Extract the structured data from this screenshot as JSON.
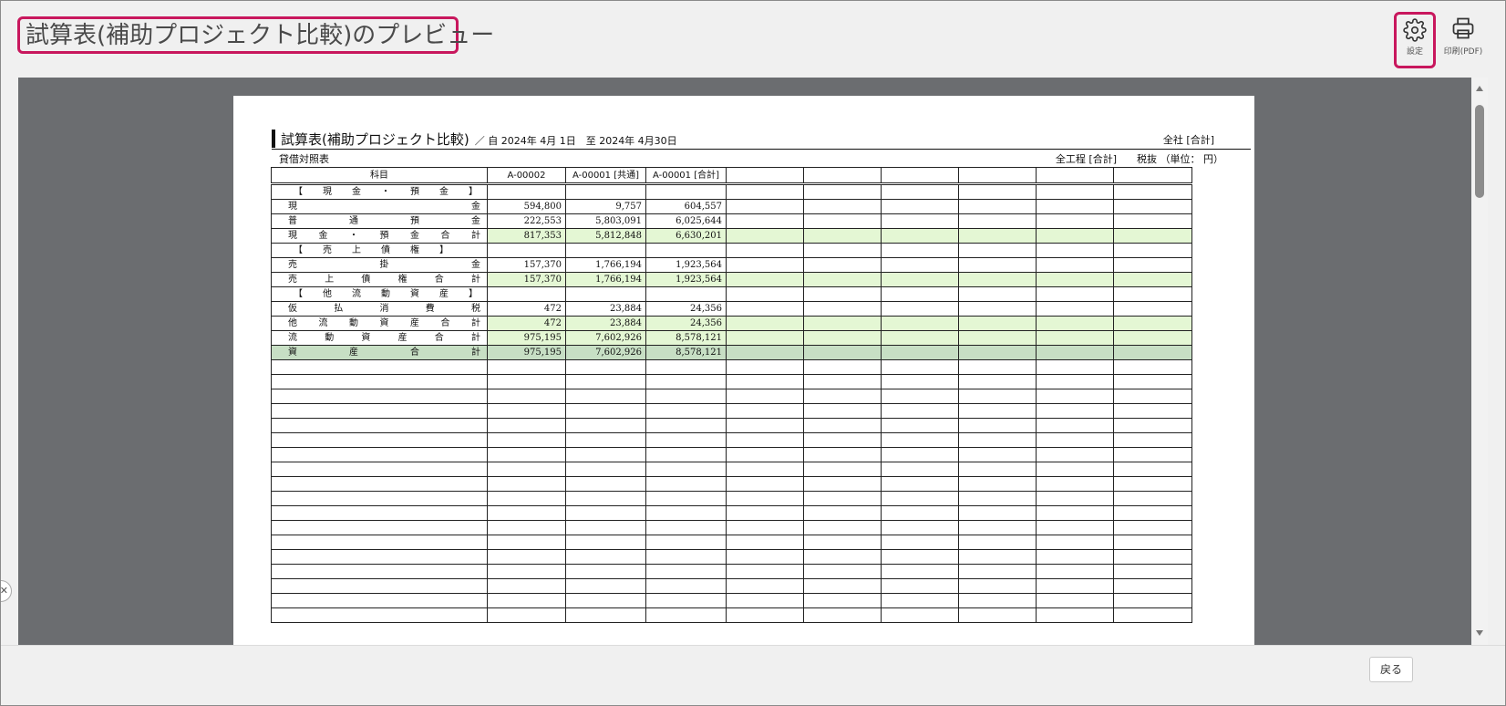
{
  "header": {
    "title": "試算表(補助プロジェクト比較)のプレビュー",
    "settings_label": "設定",
    "print_label": "印刷(PDF)"
  },
  "report": {
    "title": "試算表(補助プロジェクト比較)",
    "period": "／ 自 2024年 4月 1日　至 2024年 4月30日",
    "company": "全社 [合計]",
    "sheet": "貸借対照表",
    "meta": "全工程 [合計]　　税抜 （単位： 円）"
  },
  "table": {
    "headers": [
      "科目",
      "A-00002",
      "A-00001 [共通]",
      "A-00001 [合計]",
      "",
      "",
      "",
      "",
      "",
      ""
    ],
    "rows": [
      {
        "kind": "sec",
        "label": "【　現　金　・　預　金　】",
        "v": [
          "",
          "",
          ""
        ]
      },
      {
        "kind": "acc",
        "label": "現　　　　　　　　　金",
        "v": [
          "594,800",
          "9,757",
          "604,557"
        ]
      },
      {
        "kind": "acc",
        "label": "普　　通　　預　　金",
        "v": [
          "222,553",
          "5,803,091",
          "6,025,644"
        ]
      },
      {
        "kind": "sub",
        "label": "現　金　・　預　金　合　計",
        "v": [
          "817,353",
          "5,812,848",
          "6,630,201"
        ]
      },
      {
        "kind": "sec",
        "label": "【　売　上　債　権　】",
        "v": [
          "",
          "",
          ""
        ]
      },
      {
        "kind": "acc",
        "label": "売　　　　掛　　　　金",
        "v": [
          "157,370",
          "1,766,194",
          "1,923,564"
        ]
      },
      {
        "kind": "sub",
        "label": "売　上　債　権　合　計",
        "v": [
          "157,370",
          "1,766,194",
          "1,923,564"
        ]
      },
      {
        "kind": "sec",
        "label": "【　他　流　動　資　産　】",
        "v": [
          "",
          "",
          ""
        ]
      },
      {
        "kind": "acc",
        "label": "仮　払　消　費　税",
        "v": [
          "472",
          "23,884",
          "24,356"
        ]
      },
      {
        "kind": "sub",
        "label": "他　流　動　資　産　合　計",
        "v": [
          "472",
          "23,884",
          "24,356"
        ]
      },
      {
        "kind": "sub",
        "label": "流　動　資　産　合　計",
        "v": [
          "975,195",
          "7,602,926",
          "8,578,121"
        ]
      },
      {
        "kind": "tot",
        "label": "資　　産　　合　　計",
        "v": [
          "975,195",
          "7,602,926",
          "8,578,121"
        ]
      }
    ]
  },
  "footer": {
    "back_label": "戻る"
  }
}
